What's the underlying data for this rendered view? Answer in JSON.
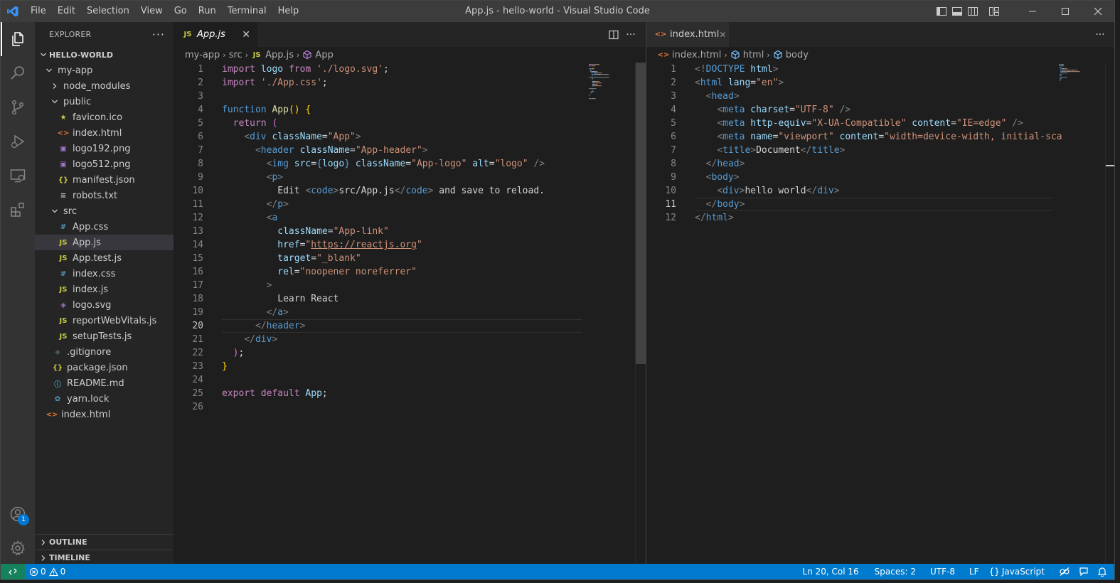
{
  "window": {
    "title": "App.js - hello-world - Visual Studio Code"
  },
  "menu": [
    "File",
    "Edit",
    "Selection",
    "View",
    "Go",
    "Run",
    "Terminal",
    "Help"
  ],
  "explorer": {
    "header": "EXPLORER",
    "root": "HELLO-WORLD",
    "tree": [
      {
        "label": "my-app",
        "depth": 1,
        "type": "folder-open"
      },
      {
        "label": "node_modules",
        "depth": 2,
        "type": "folder-closed"
      },
      {
        "label": "public",
        "depth": 2,
        "type": "folder-open"
      },
      {
        "label": "favicon.ico",
        "depth": 3,
        "type": "star"
      },
      {
        "label": "index.html",
        "depth": 3,
        "type": "html"
      },
      {
        "label": "logo192.png",
        "depth": 3,
        "type": "image"
      },
      {
        "label": "logo512.png",
        "depth": 3,
        "type": "image"
      },
      {
        "label": "manifest.json",
        "depth": 3,
        "type": "json"
      },
      {
        "label": "robots.txt",
        "depth": 3,
        "type": "text"
      },
      {
        "label": "src",
        "depth": 2,
        "type": "folder-open"
      },
      {
        "label": "App.css",
        "depth": 3,
        "type": "css"
      },
      {
        "label": "App.js",
        "depth": 3,
        "type": "js",
        "selected": true
      },
      {
        "label": "App.test.js",
        "depth": 3,
        "type": "js"
      },
      {
        "label": "index.css",
        "depth": 3,
        "type": "css"
      },
      {
        "label": "index.js",
        "depth": 3,
        "type": "js"
      },
      {
        "label": "logo.svg",
        "depth": 3,
        "type": "svg"
      },
      {
        "label": "reportWebVitals.js",
        "depth": 3,
        "type": "js"
      },
      {
        "label": "setupTests.js",
        "depth": 3,
        "type": "js"
      },
      {
        "label": ".gitignore",
        "depth": 2,
        "type": "git"
      },
      {
        "label": "package.json",
        "depth": 2,
        "type": "json"
      },
      {
        "label": "README.md",
        "depth": 2,
        "type": "info"
      },
      {
        "label": "yarn.lock",
        "depth": 2,
        "type": "yarn"
      },
      {
        "label": "index.html",
        "depth": 1,
        "type": "html"
      }
    ],
    "sections": [
      "OUTLINE",
      "TIMELINE"
    ]
  },
  "left_editor": {
    "tab": "App.js",
    "breadcrumb": [
      "my-app",
      "src",
      "App.js",
      "App"
    ],
    "current_line": 20,
    "lines": [
      [
        [
          "kw",
          "import"
        ],
        [
          "txt",
          " "
        ],
        [
          "var",
          "logo"
        ],
        [
          "txt",
          " "
        ],
        [
          "kw",
          "from"
        ],
        [
          "txt",
          " "
        ],
        [
          "str",
          "'./logo.svg'"
        ],
        [
          "txt",
          ";"
        ]
      ],
      [
        [
          "kw",
          "import"
        ],
        [
          "txt",
          " "
        ],
        [
          "str",
          "'./App.css'"
        ],
        [
          "txt",
          ";"
        ]
      ],
      [],
      [
        [
          "kb",
          "function"
        ],
        [
          "txt",
          " "
        ],
        [
          "fn",
          "App"
        ],
        [
          "brk1",
          "()"
        ],
        [
          "txt",
          " "
        ],
        [
          "brk1",
          "{"
        ]
      ],
      [
        [
          "txt",
          "  "
        ],
        [
          "kw",
          "return"
        ],
        [
          "txt",
          " "
        ],
        [
          "brk2",
          "("
        ]
      ],
      [
        [
          "txt",
          "    "
        ],
        [
          "ang",
          "<"
        ],
        [
          "tagn",
          "div"
        ],
        [
          "txt",
          " "
        ],
        [
          "attr",
          "className"
        ],
        [
          "txt",
          "="
        ],
        [
          "str",
          "\"App\""
        ],
        [
          "ang",
          ">"
        ]
      ],
      [
        [
          "txt",
          "      "
        ],
        [
          "ang",
          "<"
        ],
        [
          "tagn",
          "header"
        ],
        [
          "txt",
          " "
        ],
        [
          "attr",
          "className"
        ],
        [
          "txt",
          "="
        ],
        [
          "str",
          "\"App-header\""
        ],
        [
          "ang",
          ">"
        ]
      ],
      [
        [
          "txt",
          "        "
        ],
        [
          "ang",
          "<"
        ],
        [
          "tagn",
          "img"
        ],
        [
          "txt",
          " "
        ],
        [
          "attr",
          "src"
        ],
        [
          "txt",
          "="
        ],
        [
          "kb",
          "{"
        ],
        [
          "var",
          "logo"
        ],
        [
          "kb",
          "}"
        ],
        [
          "txt",
          " "
        ],
        [
          "attr",
          "className"
        ],
        [
          "txt",
          "="
        ],
        [
          "str",
          "\"App-logo\""
        ],
        [
          "txt",
          " "
        ],
        [
          "attr",
          "alt"
        ],
        [
          "txt",
          "="
        ],
        [
          "str",
          "\"logo\""
        ],
        [
          "txt",
          " "
        ],
        [
          "ang",
          "/>"
        ]
      ],
      [
        [
          "txt",
          "        "
        ],
        [
          "ang",
          "<"
        ],
        [
          "tagn",
          "p"
        ],
        [
          "ang",
          ">"
        ]
      ],
      [
        [
          "txt",
          "          Edit "
        ],
        [
          "ang",
          "<"
        ],
        [
          "tagn",
          "code"
        ],
        [
          "ang",
          ">"
        ],
        [
          "txt",
          "src/App.js"
        ],
        [
          "ang",
          "</"
        ],
        [
          "tagn",
          "code"
        ],
        [
          "ang",
          ">"
        ],
        [
          "txt",
          " and save to reload."
        ]
      ],
      [
        [
          "txt",
          "        "
        ],
        [
          "ang",
          "</"
        ],
        [
          "tagn",
          "p"
        ],
        [
          "ang",
          ">"
        ]
      ],
      [
        [
          "txt",
          "        "
        ],
        [
          "ang",
          "<"
        ],
        [
          "tagn",
          "a"
        ]
      ],
      [
        [
          "txt",
          "          "
        ],
        [
          "attr",
          "className"
        ],
        [
          "txt",
          "="
        ],
        [
          "str",
          "\"App-link\""
        ]
      ],
      [
        [
          "txt",
          "          "
        ],
        [
          "attr",
          "href"
        ],
        [
          "txt",
          "="
        ],
        [
          "str",
          "\""
        ],
        [
          "strl",
          "https://reactjs.org"
        ],
        [
          "str",
          "\""
        ]
      ],
      [
        [
          "txt",
          "          "
        ],
        [
          "attr",
          "target"
        ],
        [
          "txt",
          "="
        ],
        [
          "str",
          "\"_blank\""
        ]
      ],
      [
        [
          "txt",
          "          "
        ],
        [
          "attr",
          "rel"
        ],
        [
          "txt",
          "="
        ],
        [
          "str",
          "\"noopener noreferrer\""
        ]
      ],
      [
        [
          "txt",
          "        "
        ],
        [
          "ang",
          ">"
        ]
      ],
      [
        [
          "txt",
          "          Learn React"
        ]
      ],
      [
        [
          "txt",
          "        "
        ],
        [
          "ang",
          "</"
        ],
        [
          "tagn",
          "a"
        ],
        [
          "ang",
          ">"
        ]
      ],
      [
        [
          "txt",
          "      "
        ],
        [
          "ang",
          "</"
        ],
        [
          "tagn",
          "header"
        ],
        [
          "ang",
          ">"
        ]
      ],
      [
        [
          "txt",
          "    "
        ],
        [
          "ang",
          "</"
        ],
        [
          "tagn",
          "div"
        ],
        [
          "ang",
          ">"
        ]
      ],
      [
        [
          "txt",
          "  "
        ],
        [
          "brk2",
          ")"
        ],
        [
          "txt",
          ";"
        ]
      ],
      [
        [
          "brk1",
          "}"
        ]
      ],
      [],
      [
        [
          "kw",
          "export"
        ],
        [
          "txt",
          " "
        ],
        [
          "kw",
          "default"
        ],
        [
          "txt",
          " "
        ],
        [
          "var",
          "App"
        ],
        [
          "txt",
          ";"
        ]
      ],
      []
    ]
  },
  "right_editor": {
    "tab": "index.html",
    "breadcrumb": [
      "index.html",
      "html",
      "body"
    ],
    "current_line": 11,
    "lines": [
      [
        [
          "ang",
          "<!"
        ],
        [
          "tagn",
          "DOCTYPE"
        ],
        [
          "txt",
          " "
        ],
        [
          "attr",
          "html"
        ],
        [
          "ang",
          ">"
        ]
      ],
      [
        [
          "ang",
          "<"
        ],
        [
          "tagn",
          "html"
        ],
        [
          "txt",
          " "
        ],
        [
          "attr",
          "lang"
        ],
        [
          "txt",
          "="
        ],
        [
          "str",
          "\"en\""
        ],
        [
          "ang",
          ">"
        ]
      ],
      [
        [
          "txt",
          "  "
        ],
        [
          "ang",
          "<"
        ],
        [
          "tagn",
          "head"
        ],
        [
          "ang",
          ">"
        ]
      ],
      [
        [
          "txt",
          "    "
        ],
        [
          "ang",
          "<"
        ],
        [
          "tagn",
          "meta"
        ],
        [
          "txt",
          " "
        ],
        [
          "attr",
          "charset"
        ],
        [
          "txt",
          "="
        ],
        [
          "str",
          "\"UTF-8\""
        ],
        [
          "txt",
          " "
        ],
        [
          "ang",
          "/>"
        ]
      ],
      [
        [
          "txt",
          "    "
        ],
        [
          "ang",
          "<"
        ],
        [
          "tagn",
          "meta"
        ],
        [
          "txt",
          " "
        ],
        [
          "attr",
          "http-equiv"
        ],
        [
          "txt",
          "="
        ],
        [
          "str",
          "\"X-UA-Compatible\""
        ],
        [
          "txt",
          " "
        ],
        [
          "attr",
          "content"
        ],
        [
          "txt",
          "="
        ],
        [
          "str",
          "\"IE=edge\""
        ],
        [
          "txt",
          " "
        ],
        [
          "ang",
          "/>"
        ]
      ],
      [
        [
          "txt",
          "    "
        ],
        [
          "ang",
          "<"
        ],
        [
          "tagn",
          "meta"
        ],
        [
          "txt",
          " "
        ],
        [
          "attr",
          "name"
        ],
        [
          "txt",
          "="
        ],
        [
          "str",
          "\"viewport\""
        ],
        [
          "txt",
          " "
        ],
        [
          "attr",
          "content"
        ],
        [
          "txt",
          "="
        ],
        [
          "str",
          "\"width=device-width, initial-sca"
        ]
      ],
      [
        [
          "txt",
          "    "
        ],
        [
          "ang",
          "<"
        ],
        [
          "tagn",
          "title"
        ],
        [
          "ang",
          ">"
        ],
        [
          "txt",
          "Document"
        ],
        [
          "ang",
          "</"
        ],
        [
          "tagn",
          "title"
        ],
        [
          "ang",
          ">"
        ]
      ],
      [
        [
          "txt",
          "  "
        ],
        [
          "ang",
          "</"
        ],
        [
          "tagn",
          "head"
        ],
        [
          "ang",
          ">"
        ]
      ],
      [
        [
          "txt",
          "  "
        ],
        [
          "ang",
          "<"
        ],
        [
          "tagn",
          "body"
        ],
        [
          "ang",
          ">"
        ]
      ],
      [
        [
          "txt",
          "    "
        ],
        [
          "ang",
          "<"
        ],
        [
          "tagn",
          "div"
        ],
        [
          "ang",
          ">"
        ],
        [
          "txt",
          "hello world"
        ],
        [
          "ang",
          "</"
        ],
        [
          "tagn",
          "div"
        ],
        [
          "ang",
          ">"
        ]
      ],
      [
        [
          "txt",
          "  "
        ],
        [
          "ang",
          "</"
        ],
        [
          "tagn",
          "body"
        ],
        [
          "ang",
          ">"
        ]
      ],
      [
        [
          "ang",
          "</"
        ],
        [
          "tagn",
          "html"
        ],
        [
          "ang",
          ">"
        ]
      ]
    ]
  },
  "status": {
    "errors": "0",
    "warnings": "0",
    "position": "Ln 20, Col 16",
    "spaces": "Spaces: 2",
    "encoding": "UTF-8",
    "eol": "LF",
    "language": "JavaScript",
    "account_badge": "1"
  },
  "colors": {
    "accent": "#007acc",
    "remote": "#16825d",
    "js_icon": "#cbcb41",
    "html_icon": "#e37933",
    "css_icon": "#519aba",
    "json_icon": "#cbcb41",
    "svg_icon": "#a074c4"
  }
}
